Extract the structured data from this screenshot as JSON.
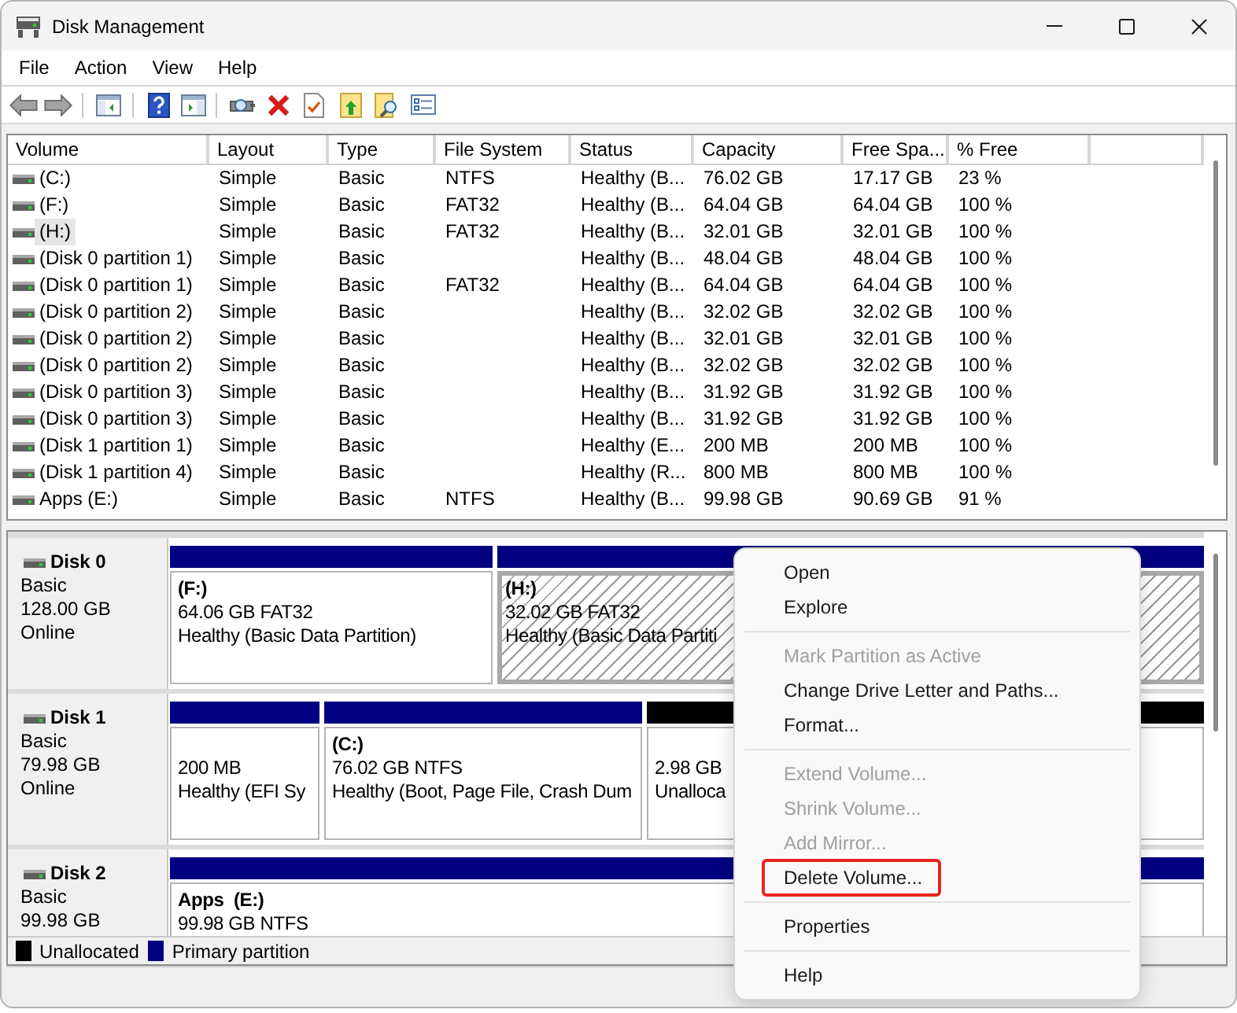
{
  "window": {
    "title": "Disk Management"
  },
  "menu_bar": [
    "File",
    "Action",
    "View",
    "Help"
  ],
  "volume_table": {
    "columns": [
      "Volume",
      "Layout",
      "Type",
      "File System",
      "Status",
      "Capacity",
      "Free Spa...",
      "% Free"
    ],
    "rows": [
      {
        "volume": "(C:)",
        "layout": "Simple",
        "type": "Basic",
        "file_system": "NTFS",
        "status": "Healthy (B...",
        "capacity": "76.02 GB",
        "free_space": "17.17 GB",
        "percent_free": "23 %",
        "selected": false
      },
      {
        "volume": "(F:)",
        "layout": "Simple",
        "type": "Basic",
        "file_system": "FAT32",
        "status": "Healthy (B...",
        "capacity": "64.04 GB",
        "free_space": "64.04 GB",
        "percent_free": "100 %",
        "selected": false
      },
      {
        "volume": "(H:)",
        "layout": "Simple",
        "type": "Basic",
        "file_system": "FAT32",
        "status": "Healthy (B...",
        "capacity": "32.01 GB",
        "free_space": "32.01 GB",
        "percent_free": "100 %",
        "selected": true
      },
      {
        "volume": "(Disk 0 partition 1)",
        "layout": "Simple",
        "type": "Basic",
        "status": "Healthy (B...",
        "capacity": "48.04 GB",
        "free_space": "48.04 GB",
        "percent_free": "100 %",
        "selected": false
      },
      {
        "volume": "(Disk 0 partition 1)",
        "layout": "Simple",
        "type": "Basic",
        "file_system": "FAT32",
        "status": "Healthy (B...",
        "capacity": "64.04 GB",
        "free_space": "64.04 GB",
        "percent_free": "100 %",
        "selected": false
      },
      {
        "volume": "(Disk 0 partition 2)",
        "layout": "Simple",
        "type": "Basic",
        "status": "Healthy (B...",
        "capacity": "32.02 GB",
        "free_space": "32.02 GB",
        "percent_free": "100 %",
        "selected": false
      },
      {
        "volume": "(Disk 0 partition 2)",
        "layout": "Simple",
        "type": "Basic",
        "status": "Healthy (B...",
        "capacity": "32.01 GB",
        "free_space": "32.01 GB",
        "percent_free": "100 %",
        "selected": false
      },
      {
        "volume": "(Disk 0 partition 2)",
        "layout": "Simple",
        "type": "Basic",
        "status": "Healthy (B...",
        "capacity": "32.02 GB",
        "free_space": "32.02 GB",
        "percent_free": "100 %",
        "selected": false
      },
      {
        "volume": "(Disk 0 partition 3)",
        "layout": "Simple",
        "type": "Basic",
        "status": "Healthy (B...",
        "capacity": "31.92 GB",
        "free_space": "31.92 GB",
        "percent_free": "100 %",
        "selected": false
      },
      {
        "volume": "(Disk 0 partition 3)",
        "layout": "Simple",
        "type": "Basic",
        "status": "Healthy (B...",
        "capacity": "31.92 GB",
        "free_space": "31.92 GB",
        "percent_free": "100 %",
        "selected": false
      },
      {
        "volume": "(Disk 1 partition 1)",
        "layout": "Simple",
        "type": "Basic",
        "status": "Healthy (E...",
        "capacity": "200 MB",
        "free_space": "200 MB",
        "percent_free": "100 %",
        "selected": false
      },
      {
        "volume": "(Disk 1 partition 4)",
        "layout": "Simple",
        "type": "Basic",
        "status": "Healthy (R...",
        "capacity": "800 MB",
        "free_space": "800 MB",
        "percent_free": "100 %",
        "selected": false
      },
      {
        "volume": "Apps (E:)",
        "layout": "Simple",
        "type": "Basic",
        "file_system": "NTFS",
        "status": "Healthy (B...",
        "capacity": "99.98 GB",
        "free_space": "90.69 GB",
        "percent_free": "91 %",
        "selected": false
      }
    ]
  },
  "disks": [
    {
      "name": "Disk 0",
      "type": "Basic",
      "size": "128.00 GB",
      "status": "Online",
      "partitions": [
        {
          "kind": "primary",
          "label": "(F:)",
          "size": "64.06 GB FAT32",
          "status": "Healthy (Basic Data Partition)",
          "selected": false
        },
        {
          "kind": "primary",
          "label": "(H:)",
          "size": "32.02 GB FAT32",
          "status": "Healthy (Basic Data Partiti",
          "selected": true
        }
      ]
    },
    {
      "name": "Disk 1",
      "type": "Basic",
      "size": "79.98 GB",
      "status": "Online",
      "partitions": [
        {
          "kind": "primary",
          "size": "200 MB",
          "status": "Healthy (EFI Sy",
          "selected": false
        },
        {
          "kind": "primary",
          "label": "(C:)",
          "size": "76.02 GB NTFS",
          "status": "Healthy (Boot, Page File, Crash Dum",
          "selected": false
        },
        {
          "kind": "unallocated",
          "size": "2.98 GB",
          "status": "Unalloca",
          "selected": false
        }
      ]
    },
    {
      "name": "Disk 2",
      "type": "Basic",
      "size": "99.98 GB",
      "partitions": [
        {
          "kind": "primary",
          "label": "Apps  (E:)",
          "size": "99.98 GB NTFS",
          "selected": false
        }
      ]
    }
  ],
  "legend": [
    {
      "label": "Unallocated",
      "color": "#000000"
    },
    {
      "label": "Primary partition",
      "color": "#000080"
    }
  ],
  "context_menu": {
    "items": [
      {
        "kind": "item",
        "label": "Open",
        "disabled": false,
        "highlighted": false
      },
      {
        "kind": "item",
        "label": "Explore",
        "disabled": false,
        "highlighted": false
      },
      {
        "kind": "separator"
      },
      {
        "kind": "item",
        "label": "Mark Partition as Active",
        "disabled": true,
        "highlighted": false
      },
      {
        "kind": "item",
        "label": "Change Drive Letter and Paths...",
        "disabled": false,
        "highlighted": false
      },
      {
        "kind": "item",
        "label": "Format...",
        "disabled": false,
        "highlighted": false
      },
      {
        "kind": "separator"
      },
      {
        "kind": "item",
        "label": "Extend Volume...",
        "disabled": true,
        "highlighted": false
      },
      {
        "kind": "item",
        "label": "Shrink Volume...",
        "disabled": true,
        "highlighted": false
      },
      {
        "kind": "item",
        "label": "Add Mirror...",
        "disabled": true,
        "highlighted": false
      },
      {
        "kind": "item",
        "label": "Delete Volume...",
        "disabled": false,
        "highlighted": true
      },
      {
        "kind": "separator"
      },
      {
        "kind": "item",
        "label": "Properties",
        "disabled": false,
        "highlighted": false
      },
      {
        "kind": "separator"
      },
      {
        "kind": "item",
        "label": "Help",
        "disabled": false,
        "highlighted": false
      }
    ]
  }
}
